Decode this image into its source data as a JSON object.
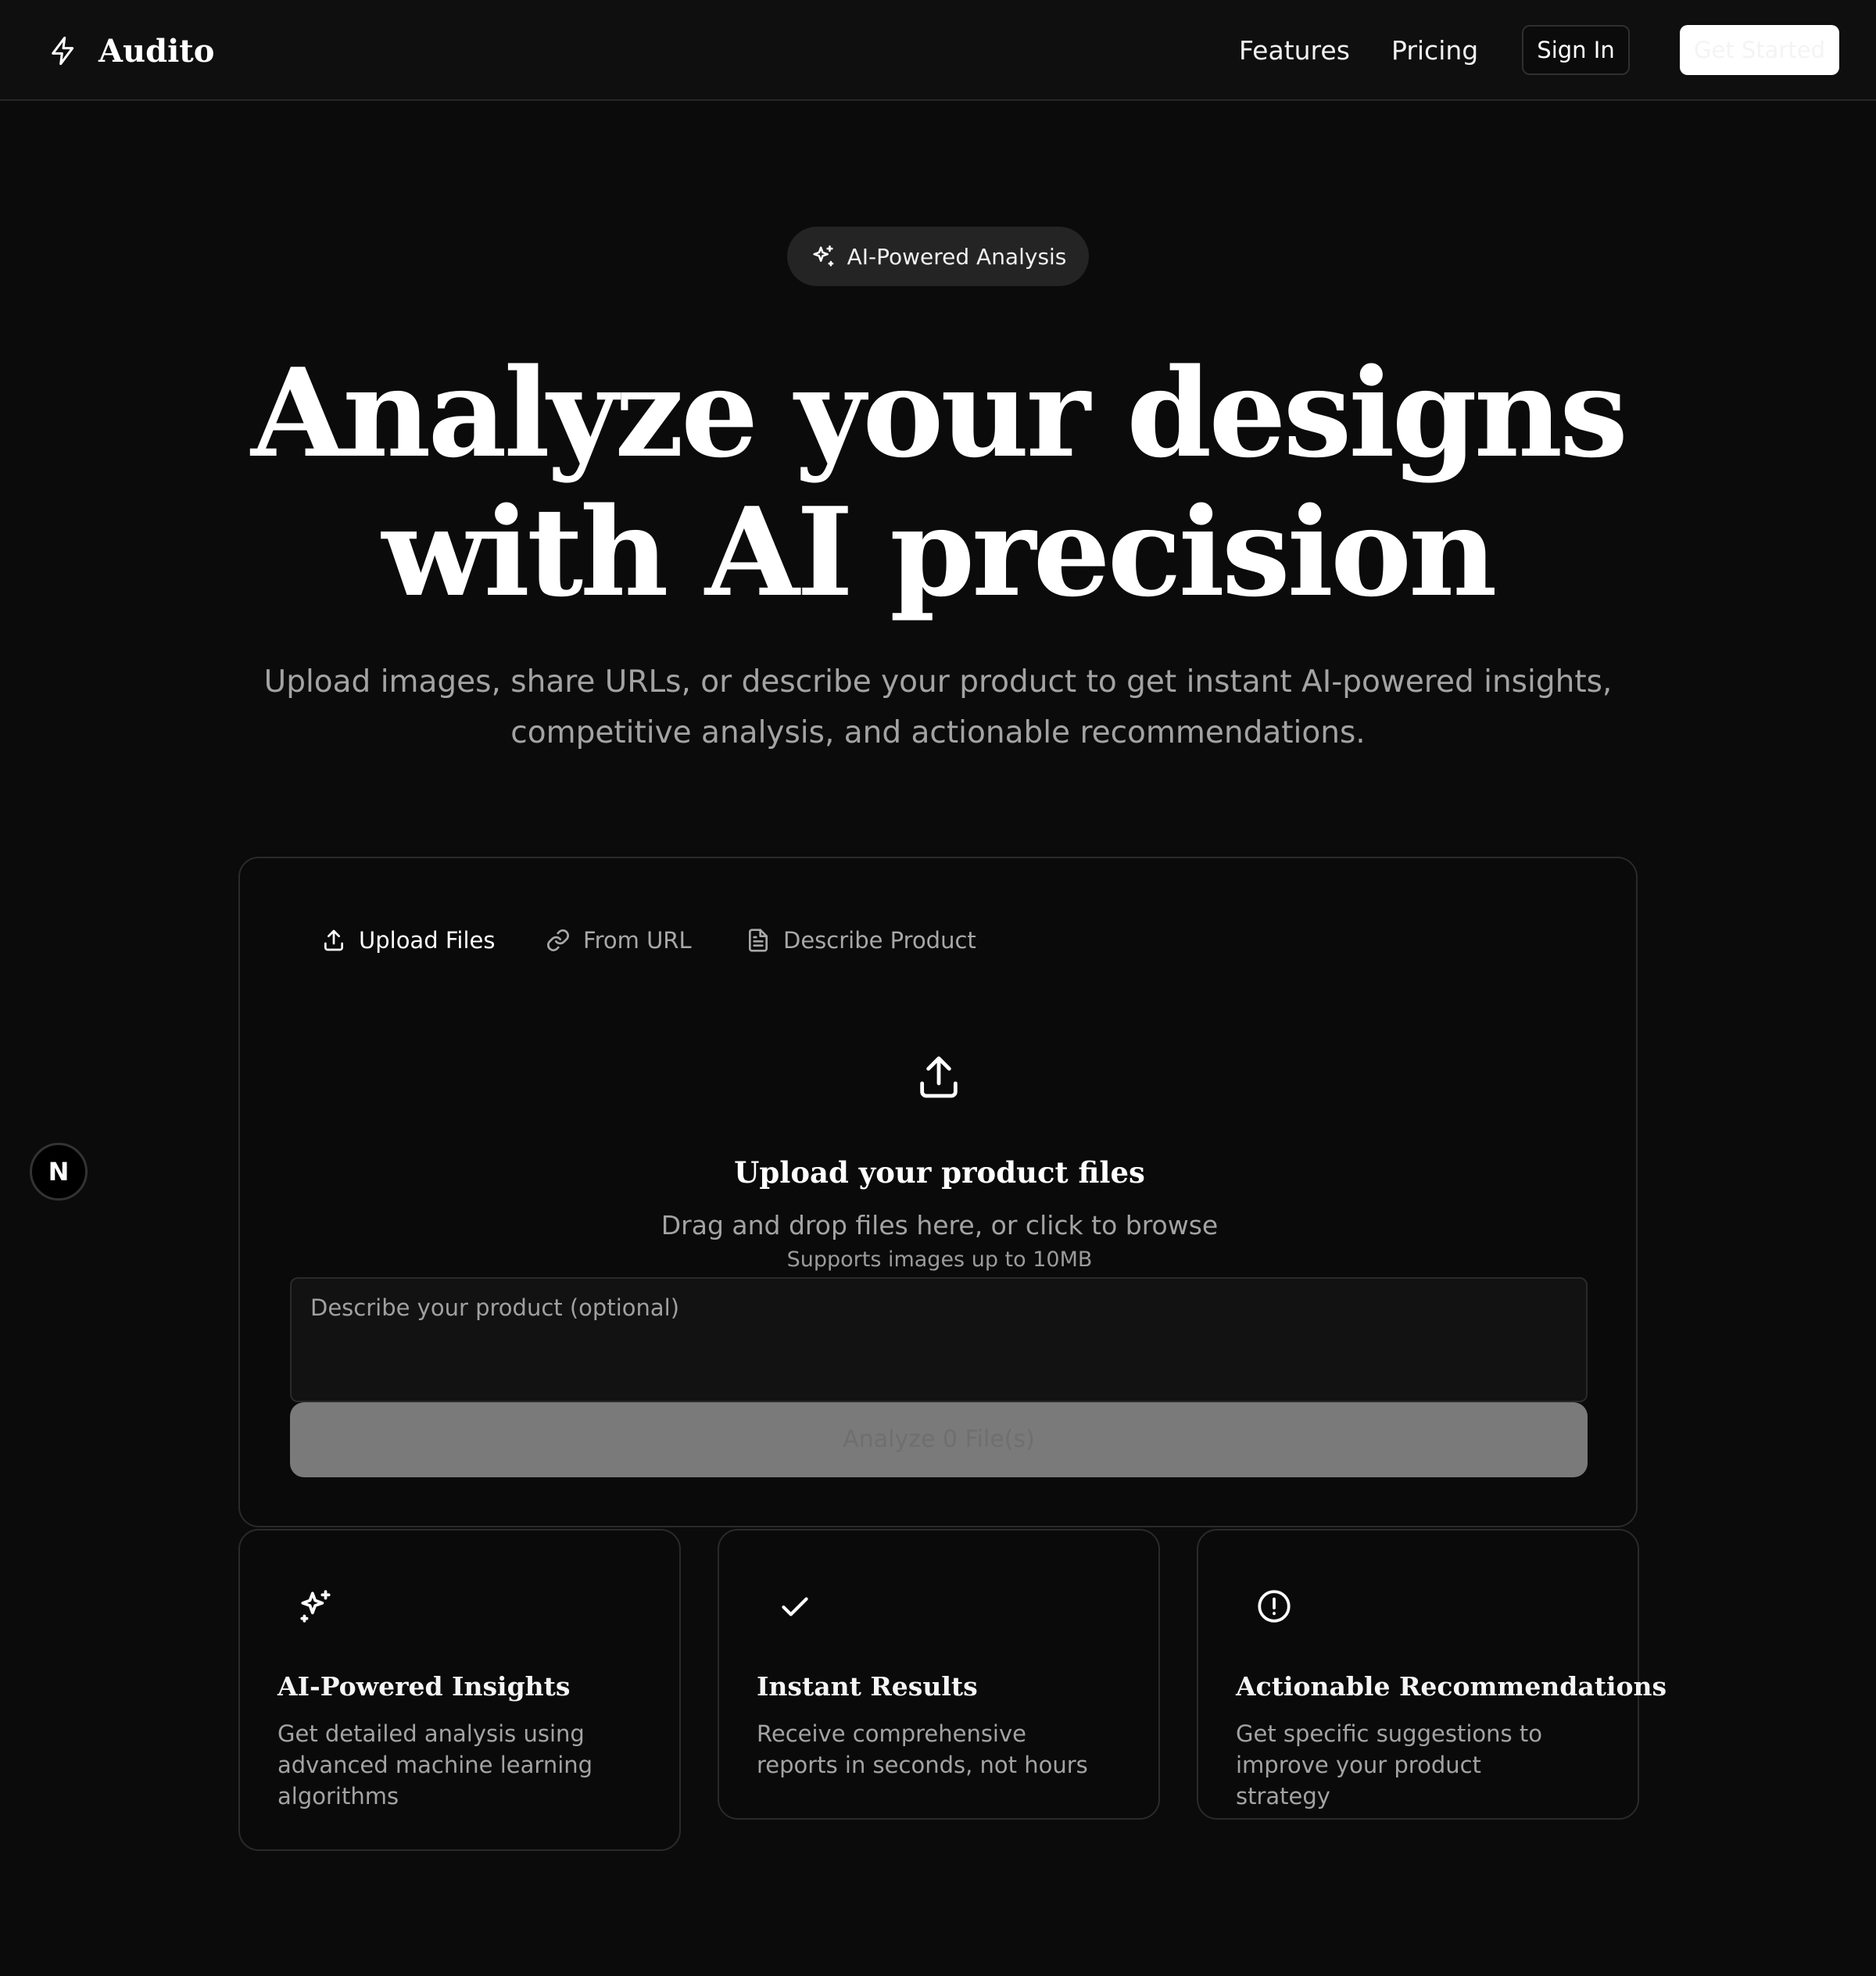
{
  "nav": {
    "brand": "Audito",
    "brand_icon": "lightning-bolt-icon",
    "links": [
      "Features",
      "Pricing"
    ],
    "signin_label": "Sign In",
    "get_started_label": "Get Started"
  },
  "hero": {
    "badge_label": "AI-Powered Analysis",
    "title_line1": "Analyze your designs",
    "title_line2": "with AI precision",
    "subtitle": "Upload images, share URLs, or describe your product to get instant AI-powered insights, competitive analysis, and actionable recommendations."
  },
  "analyzer": {
    "tabs": [
      {
        "label": "Upload Files",
        "icon": "upload-icon",
        "active": true
      },
      {
        "label": "From URL",
        "icon": "link-icon",
        "active": false
      },
      {
        "label": "Describe Product",
        "icon": "document-icon",
        "active": false
      }
    ],
    "drop_title": "Upload your product files",
    "drop_subtitle": "Drag and drop files here, or click to browse",
    "drop_note": "Supports images up to 10MB",
    "description_placeholder": "Describe your product (optional)",
    "analyze_label": "Analyze 0 File(s)"
  },
  "features": [
    {
      "title": "AI-Powered Insights",
      "description": "Get detailed analysis using advanced machine learning algorithms",
      "icon": "sparkles-icon"
    },
    {
      "title": "Instant Results",
      "description": "Receive comprehensive reports in seconds, not hours",
      "icon": "check-icon"
    },
    {
      "title": "Actionable Recommendations",
      "description": "Get specific suggestions to improve your product strategy",
      "icon": "alert-circle-icon"
    }
  ],
  "floating_badge": "N",
  "colors": {
    "background": "#0b0b0b",
    "text": "#ffffff",
    "muted_text": "#a3a3a3",
    "border": "#2a2a2a",
    "disabled_button": "#7a7a7a"
  }
}
